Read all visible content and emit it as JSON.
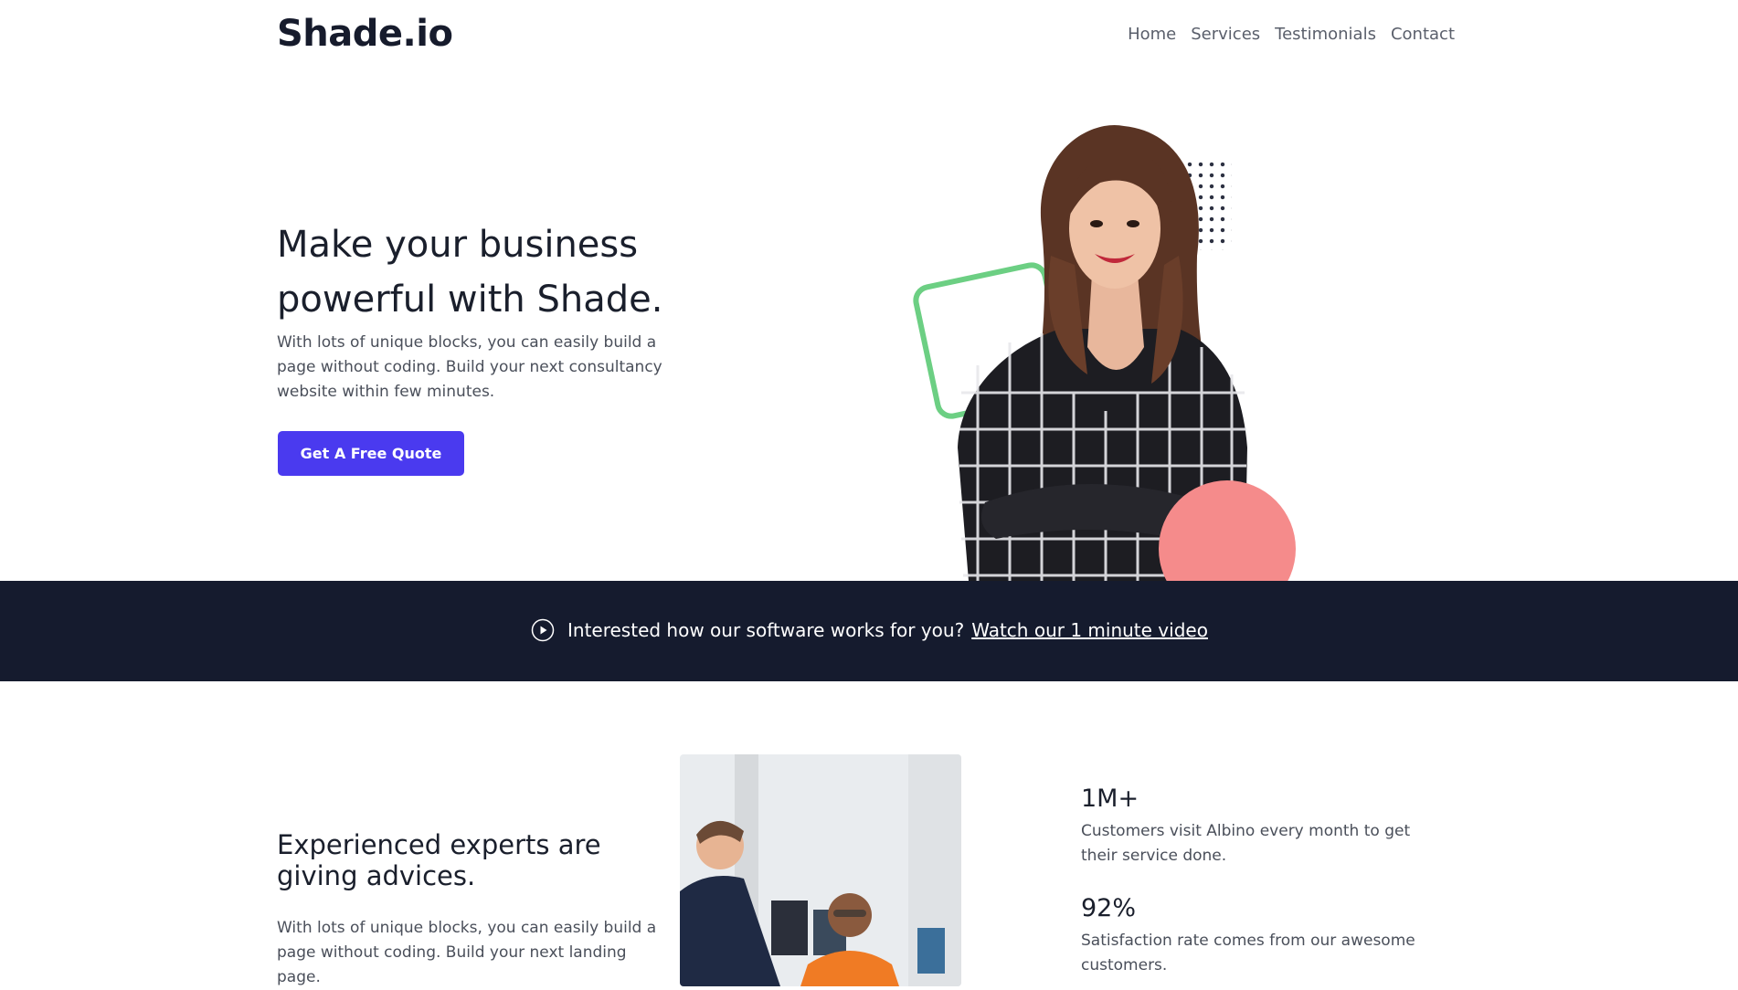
{
  "brand": {
    "logo": "Shade.io"
  },
  "nav": {
    "links": [
      "Home",
      "Services",
      "Testimonials",
      "Contact"
    ]
  },
  "hero": {
    "title": "Make your business powerful with Shade.",
    "text": "With lots of unique blocks, you can easily build a page without coding. Build your next consultancy website within few minutes.",
    "cta_label": "Get A Free Quote"
  },
  "banner": {
    "text": "Interested how our software works for you?",
    "link_label": "Watch our 1 minute video"
  },
  "experts": {
    "title": "Experienced experts are giving advices.",
    "text": "With lots of unique blocks, you can easily build a page without coding. Build your next landing page."
  },
  "stats": [
    {
      "value": "1M+",
      "text": "Customers visit Albino every month to get their service done."
    },
    {
      "value": "92%",
      "text": "Satisfaction rate comes from our awesome customers."
    }
  ],
  "colors": {
    "primary": "#4a3aef",
    "dark": "#151b2e",
    "accent_green": "#6ccf83",
    "accent_pink": "#f58b8b"
  },
  "icons": {
    "play": "play-circle-icon"
  }
}
